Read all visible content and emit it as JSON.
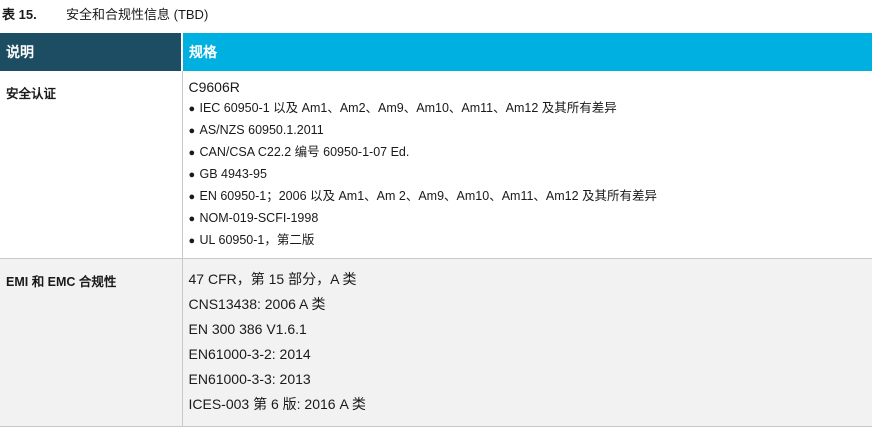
{
  "caption": {
    "number": "表 15.",
    "title": "安全和合规性信息 (TBD)"
  },
  "table": {
    "headers": [
      "说明",
      "规格"
    ],
    "safety": {
      "label": "安全认证",
      "model": "C9606R",
      "items": [
        "IEC 60950-1 以及 Am1、Am2、Am9、Am10、Am11、Am12 及其所有差异",
        "AS/NZS 60950.1.2011",
        "CAN/CSA C22.2 编号 60950-1-07 Ed.",
        "GB 4943-95",
        "EN 60950-1；2006 以及 Am1、Am 2、Am9、Am10、Am11、Am12 及其所有差异",
        "NOM-019-SCFI-1998",
        "UL 60950-1，第二版"
      ]
    },
    "emc": {
      "label": "EMI 和 EMC 合规性",
      "items": [
        "47 CFR，第 15 部分，A 类",
        "CNS13438: 2006 A 类",
        "EN 300 386 V1.6.1",
        "EN61000-3-2: 2014",
        "EN61000-3-3: 2013",
        "ICES-003 第 6 版: 2016 A 类"
      ]
    }
  }
}
